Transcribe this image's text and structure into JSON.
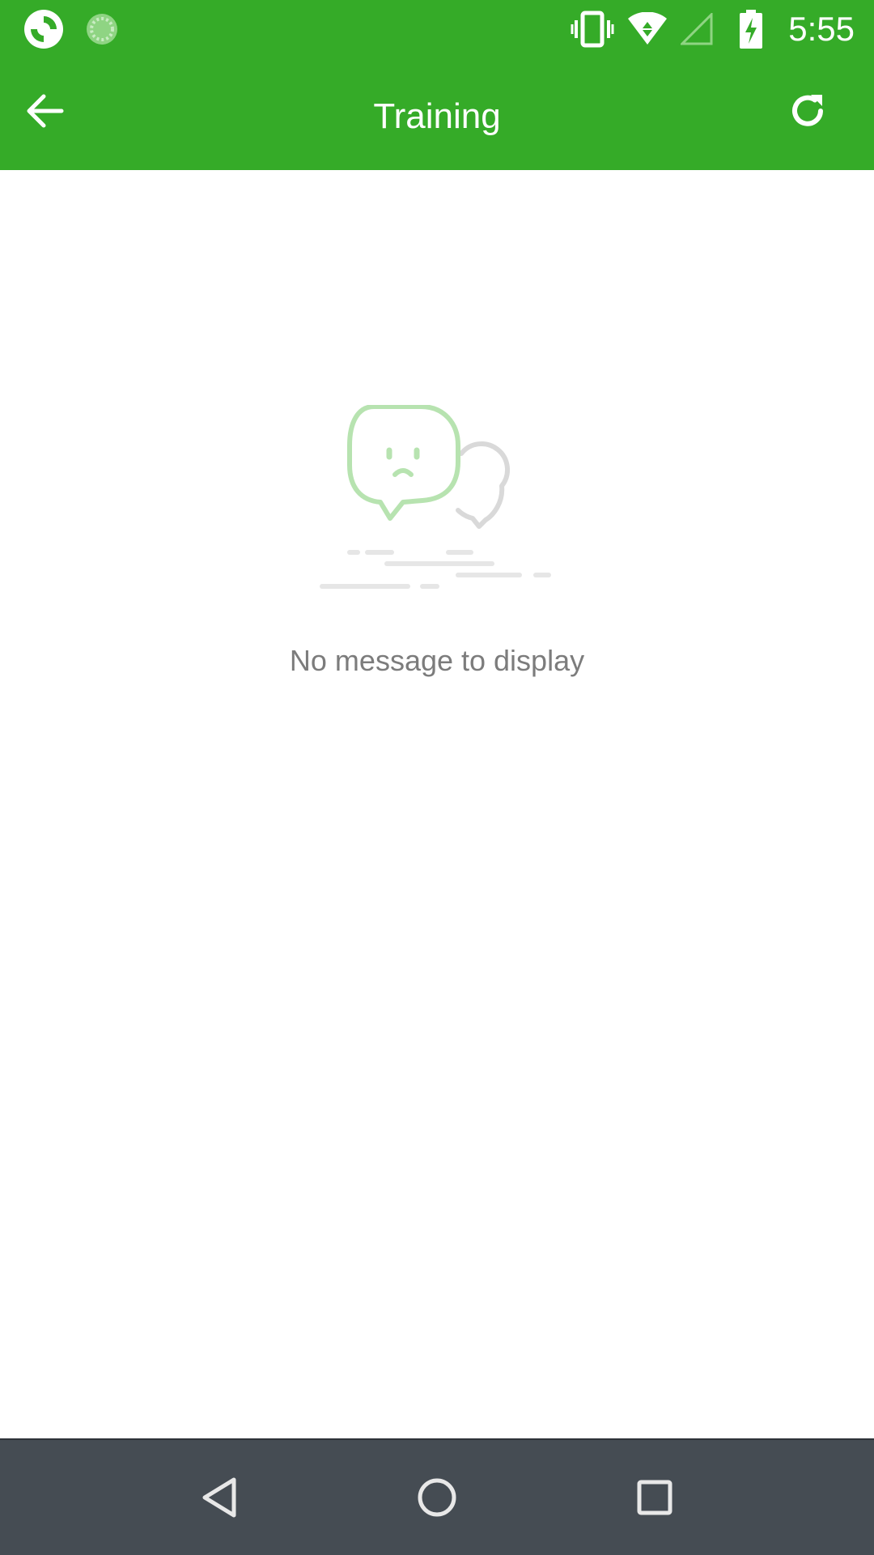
{
  "status_bar": {
    "time": "5:55",
    "icons": [
      "app-logo-icon",
      "loading-icon",
      "vibrate-icon",
      "wifi-icon",
      "signal-icon",
      "battery-charging-icon"
    ]
  },
  "app_bar": {
    "title": "Training",
    "back_icon": "arrow-back-icon",
    "refresh_icon": "refresh-icon"
  },
  "empty_state": {
    "message": "No message to display",
    "illustration": "sad-chat-bubble-icon"
  },
  "nav_bar": {
    "buttons": [
      "back-triangle-icon",
      "home-circle-icon",
      "recents-square-icon"
    ]
  },
  "colors": {
    "primary": "#35ab28",
    "nav_bar": "#454c53",
    "empty_text": "#7c7c7c",
    "illustration_green": "#b7e3b0",
    "illustration_gray": "#d9d9d9"
  }
}
